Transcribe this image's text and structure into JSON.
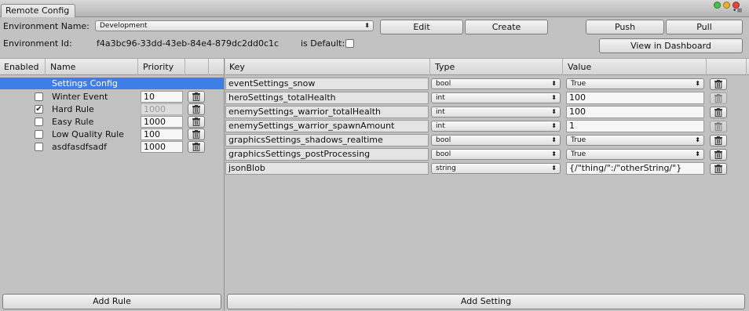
{
  "window": {
    "tab_title": "Remote Config",
    "menu_glyph": "•≡"
  },
  "toolbar": {
    "env_name_label": "Environment Name:",
    "env_name_value": "Development",
    "env_id_label": "Environment Id:",
    "env_id_value": "f4a3bc96-33dd-43eb-84e4-879dc2dd0c1c",
    "is_default_label": "is Default:",
    "edit_label": "Edit",
    "create_label": "Create",
    "push_label": "Push",
    "pull_label": "Pull",
    "dashboard_label": "View in Dashboard"
  },
  "rules": {
    "headers": {
      "enabled": "Enabled",
      "name": "Name",
      "priority": "Priority"
    },
    "settings_config_label": "Settings Config",
    "items": [
      {
        "name": "Winter Event",
        "priority": "10",
        "enabled": false,
        "disabled_priority": false
      },
      {
        "name": "Hard Rule",
        "priority": "1000",
        "enabled": true,
        "disabled_priority": true
      },
      {
        "name": "Easy Rule",
        "priority": "1000",
        "enabled": false,
        "disabled_priority": false
      },
      {
        "name": "Low Quality Rule",
        "priority": "100",
        "enabled": false,
        "disabled_priority": false
      },
      {
        "name": "asdfasdfsadf",
        "priority": "1000",
        "enabled": false,
        "disabled_priority": false
      }
    ],
    "add_rule_label": "Add Rule"
  },
  "settings": {
    "headers": {
      "key": "Key",
      "type": "Type",
      "value": "Value"
    },
    "items": [
      {
        "key": "eventSettings_snow",
        "type": "bool",
        "value": "True",
        "value_is_dropdown": true,
        "trash_disabled": false
      },
      {
        "key": "heroSettings_totalHealth",
        "type": "int",
        "value": "100",
        "value_is_dropdown": false,
        "trash_disabled": true
      },
      {
        "key": "enemySettings_warrior_totalHealth",
        "type": "int",
        "value": "100",
        "value_is_dropdown": false,
        "trash_disabled": false
      },
      {
        "key": "enemySettings_warrior_spawnAmount",
        "type": "int",
        "value": "1",
        "value_is_dropdown": false,
        "trash_disabled": true
      },
      {
        "key": "graphicsSettings_shadows_realtime",
        "type": "bool",
        "value": "True",
        "value_is_dropdown": true,
        "trash_disabled": false
      },
      {
        "key": "graphicsSettings_postProcessing",
        "type": "bool",
        "value": "True",
        "value_is_dropdown": true,
        "trash_disabled": false
      },
      {
        "key": "jsonBlob",
        "type": "string",
        "value": "{/\"thing/\":/\"otherString/\"}",
        "value_is_dropdown": false,
        "trash_disabled": false
      }
    ],
    "add_setting_label": "Add Setting"
  },
  "colors": {
    "selection": "#3d7fe6",
    "window_bg": "#c2c2c2",
    "close_dot": "#e0443e",
    "minimize_dot": "#dea123",
    "zoom_dot": "#27aa35"
  }
}
